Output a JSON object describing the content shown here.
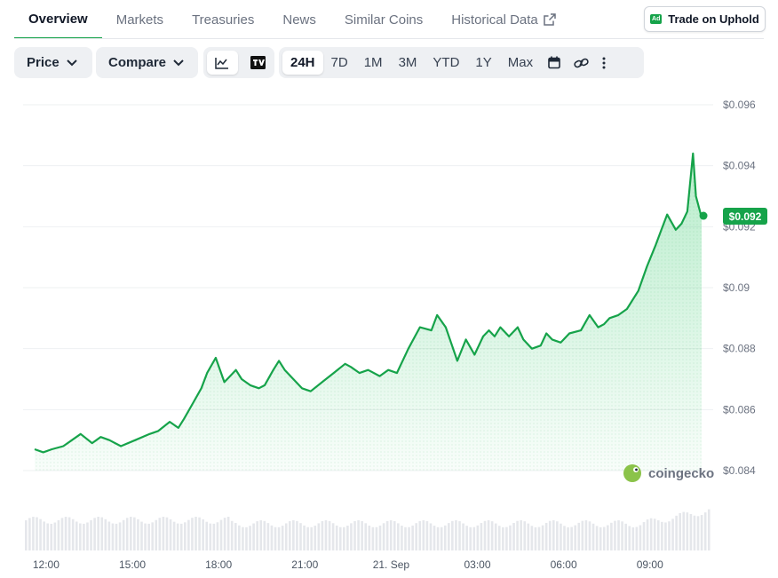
{
  "tabs": [
    {
      "label": "Overview",
      "active": true
    },
    {
      "label": "Markets"
    },
    {
      "label": "Treasuries"
    },
    {
      "label": "News"
    },
    {
      "label": "Similar Coins"
    },
    {
      "label": "Historical Data",
      "external": true
    }
  ],
  "ad": {
    "badge": "Ad",
    "label": "Trade on Uphold"
  },
  "toolbar": {
    "price_label": "Price",
    "compare_label": "Compare",
    "chart_types": [
      "line-chart-icon",
      "tradingview-icon"
    ],
    "ranges": [
      "24H",
      "7D",
      "1M",
      "3M",
      "YTD",
      "1Y",
      "Max"
    ],
    "active_range": "24H",
    "extra_icons": [
      "calendar-icon",
      "link-icon",
      "more-icon"
    ]
  },
  "colors": {
    "line": "#16a34a",
    "fill": "#22c55e",
    "badge": "#16a34a",
    "grid": "#eef0f2",
    "volume": "#e5e7eb"
  },
  "watermark": "coingecko",
  "chart_data": {
    "type": "area",
    "title": "",
    "xlabel": "",
    "ylabel": "",
    "ylim": [
      0.0835,
      0.0962
    ],
    "y_ticks": [
      0.096,
      0.094,
      0.092,
      0.09,
      0.088,
      0.086,
      0.084
    ],
    "y_tick_labels": [
      "$0.096",
      "$0.094",
      "$0.092",
      "$0.09",
      "$0.088",
      "$0.086",
      "$0.084"
    ],
    "x_tick_labels": [
      "12:00",
      "15:00",
      "18:00",
      "21:00",
      "21. Sep",
      "03:00",
      "06:00",
      "09:00"
    ],
    "x_range_hours": [
      -0.4,
      23.6
    ],
    "current_price_label": "$0.092",
    "current_price": 0.0923,
    "series": [
      {
        "x": [
          0.0,
          0.3,
          0.6,
          1.0,
          1.3,
          1.6,
          2.0,
          2.3,
          2.6,
          3.0,
          3.5,
          4.0,
          4.3,
          4.7,
          5.0,
          5.2,
          5.5,
          5.8,
          6.0,
          6.3,
          6.6,
          7.0,
          7.2,
          7.5,
          7.8,
          8.0,
          8.3,
          8.5,
          8.7,
          9.0,
          9.3,
          9.6,
          10.0,
          10.4,
          10.8,
          11.0,
          11.3,
          11.6,
          12.0,
          12.3,
          12.6,
          13.0,
          13.4,
          13.8,
          14.0,
          14.3,
          14.7,
          15.0,
          15.3,
          15.6,
          15.8,
          16.0,
          16.2,
          16.5,
          16.8,
          17.0,
          17.3,
          17.6,
          17.8,
          18.0,
          18.3,
          18.6,
          19.0,
          19.3,
          19.6,
          19.8,
          20.0,
          20.3,
          20.6,
          21.0,
          21.3,
          21.6,
          21.8,
          22.0,
          22.3,
          22.5,
          22.7,
          22.9,
          23.0,
          23.2
        ],
        "y": [
          0.0847,
          0.0846,
          0.0847,
          0.0848,
          0.085,
          0.0852,
          0.0849,
          0.0851,
          0.085,
          0.0848,
          0.085,
          0.0852,
          0.0853,
          0.0856,
          0.0854,
          0.0857,
          0.0862,
          0.0867,
          0.0872,
          0.0877,
          0.0869,
          0.0873,
          0.087,
          0.0868,
          0.0867,
          0.0868,
          0.0873,
          0.0876,
          0.0873,
          0.087,
          0.0867,
          0.0866,
          0.0869,
          0.0872,
          0.0875,
          0.0874,
          0.0872,
          0.0873,
          0.0871,
          0.0873,
          0.0872,
          0.088,
          0.0887,
          0.0886,
          0.0891,
          0.0887,
          0.0876,
          0.0883,
          0.0878,
          0.0884,
          0.0886,
          0.0884,
          0.0887,
          0.0884,
          0.0887,
          0.0883,
          0.088,
          0.0881,
          0.0885,
          0.0883,
          0.0882,
          0.0885,
          0.0886,
          0.0891,
          0.0887,
          0.0888,
          0.089,
          0.0891,
          0.0893,
          0.0899,
          0.0907,
          0.0914,
          0.0919,
          0.0924,
          0.0919,
          0.0921,
          0.0925,
          0.0944,
          0.093,
          0.0923
        ]
      }
    ],
    "volume": "relative bars along the bottom, rising towards the right"
  }
}
